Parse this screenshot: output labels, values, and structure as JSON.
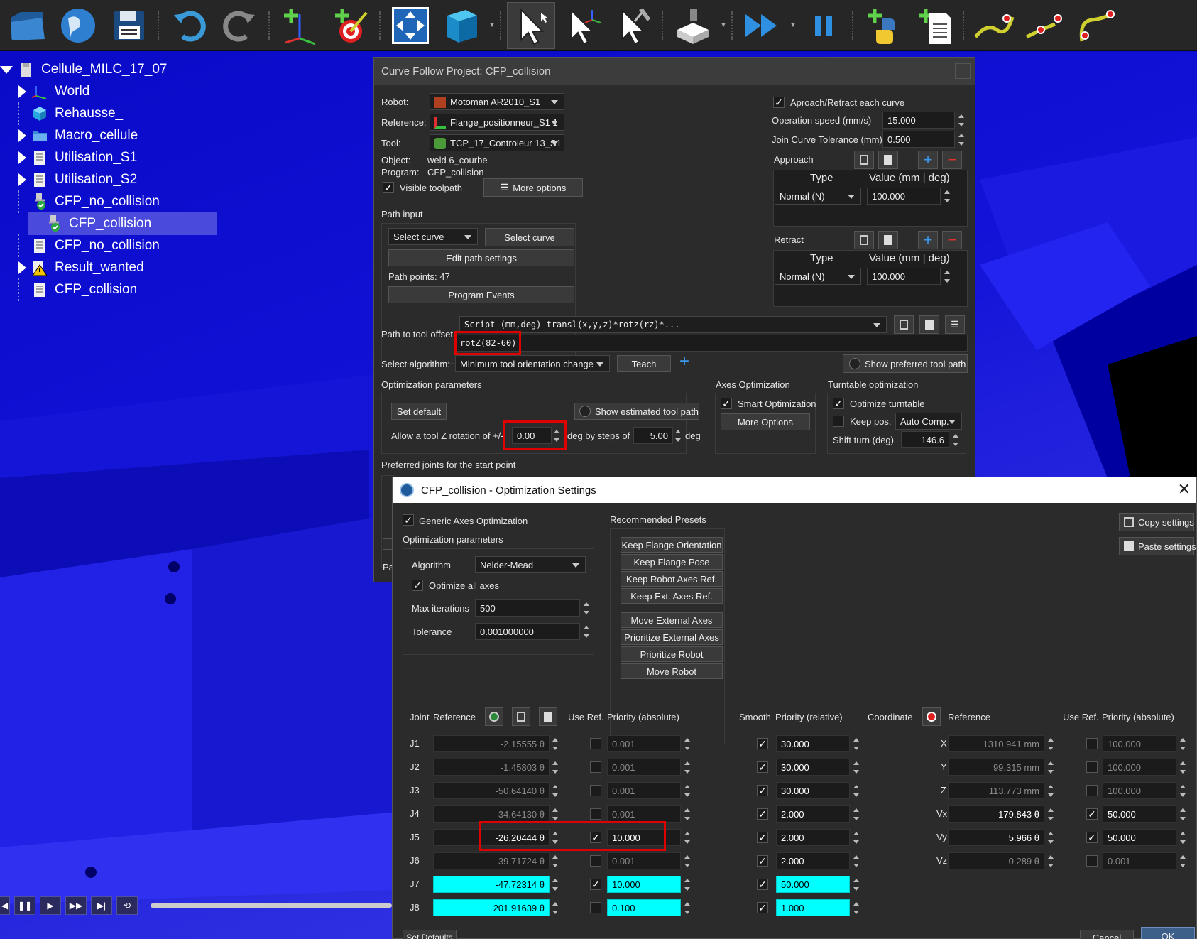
{
  "toolbar": {
    "icons": [
      "open-folder-icon",
      "globe-icon",
      "save-icon",
      "undo-icon",
      "redo-icon",
      "add-reference-frame-icon",
      "add-target-icon",
      "fit-all-icon",
      "cube-view-icon",
      "select-pointer-icon",
      "select-frame-icon",
      "select-tool-icon",
      "tool-holder-icon",
      "fast-forward-icon",
      "pause-icon",
      "python-icon",
      "new-program-icon",
      "curve-point-icon",
      "curve-follow-icon",
      "curve-path-icon"
    ]
  },
  "tree": {
    "root": "Cellule_MILC_17_07",
    "items": [
      {
        "label": "World",
        "icon": "reference-frame-icon"
      },
      {
        "label": "Rehausse_",
        "icon": "cube-icon"
      },
      {
        "label": "Macro_cellule",
        "icon": "folder-icon"
      },
      {
        "label": "Utilisation_S1",
        "icon": "program-icon"
      },
      {
        "label": "Utilisation_S2",
        "icon": "program-icon"
      },
      {
        "label": "CFP_no_collision",
        "icon": "curve-follow-ok-icon"
      },
      {
        "label": "CFP_collision",
        "icon": "curve-follow-ok-icon"
      },
      {
        "label": "CFP_no_collision",
        "icon": "program-icon"
      },
      {
        "label": "Result_wanted",
        "icon": "warning-icon"
      },
      {
        "label": "CFP_collision",
        "icon": "program-icon"
      }
    ]
  },
  "main": {
    "title": "Curve Follow Project: CFP_collision",
    "robot_label": "Robot:",
    "robot_value": "Motoman AR2010_S1",
    "reference_label": "Reference:",
    "reference_value": "Flange_positionneur_S1 1",
    "tool_label": "Tool:",
    "tool_value": "TCP_17_Controleur 13_S1",
    "object_label": "Object:",
    "object_value": "weld 6_courbe",
    "program_label": "Program:",
    "program_value": "CFP_collision",
    "visible_toolpath": "Visible toolpath",
    "more_options": "More options",
    "path_input": "Path input",
    "select_curve_combo": "Select curve",
    "select_curve_btn": "Select curve",
    "edit_path_settings": "Edit path settings",
    "path_points": "Path points: 47",
    "program_events": "Program Events",
    "approach_retract": "Aproach/Retract each curve",
    "op_speed_label": "Operation speed (mm/s)",
    "op_speed_value": "15.000",
    "join_tol_label": "Join Curve Tolerance (mm)",
    "join_tol_value": "0.500",
    "approach": "Approach",
    "retract": "Retract",
    "type_header": "Type",
    "value_header": "Value (mm | deg)",
    "approach_type": "Normal (N)",
    "approach_value": "100.000",
    "retract_type": "Normal (N)",
    "retract_value": "100.000",
    "path_tool_offset_label": "Path to tool offset",
    "script_combo": "Script (mm,deg) transl(x,y,z)*rotz(rz)*...",
    "offset_value": "rotZ(82-60)",
    "select_algorithm_label": "Select algorithm:",
    "algorithm_value": "Minimum tool orientation change",
    "teach": "Teach",
    "show_preferred": "Show preferred tool path",
    "opt_params": "Optimization parameters",
    "set_default": "Set default",
    "show_estimated": "Show estimated tool path",
    "allow_rot_label": "Allow a tool Z rotation of +/-",
    "allow_rot_value": "0.00",
    "deg_steps_label": "deg by steps of",
    "steps_value": "5.00",
    "deg": "deg",
    "axes_opt": "Axes Optimization",
    "smart_opt": "Smart Optimization",
    "more_options2": "More Options",
    "turntable_opt": "Turntable optimization",
    "optimize_turntable": "Optimize turntable",
    "keep_pos": "Keep pos.",
    "auto_comp": "Auto Comp.",
    "shift_turn_label": "Shift turn (deg)",
    "shift_turn_value": "146.6",
    "preferred_joints": "Preferred joints for the start point",
    "pa_text": "Pa"
  },
  "opt": {
    "title": "CFP_collision - Optimization Settings",
    "generic": "Generic Axes Optimization",
    "opt_params": "Optimization parameters",
    "algorithm_label": "Algorithm",
    "algorithm_value": "Nelder-Mead",
    "optimize_all": "Optimize all axes",
    "max_iter_label": "Max iterations",
    "max_iter_value": "500",
    "tolerance_label": "Tolerance",
    "tolerance_value": "0.001000000",
    "presets_title": "Recommended Presets",
    "presets": [
      "Keep Flange Orientation",
      "Keep Flange Pose",
      "Keep Robot Axes Ref.",
      "Keep Ext. Axes Ref.",
      "Move External Axes",
      "Prioritize External Axes",
      "Prioritize Robot",
      "Move Robot"
    ],
    "copy_settings": "Copy settings",
    "paste_settings": "Paste settings",
    "headers": {
      "joint": "Joint",
      "reference": "Reference",
      "use_ref": "Use Ref.",
      "priority_abs": "Priority (absolute)",
      "smooth": "Smooth",
      "priority_rel": "Priority (relative)",
      "coordinate": "Coordinate",
      "reference2": "Reference",
      "use_ref2": "Use Ref.",
      "priority_abs2": "Priority (absolute)"
    },
    "joints": [
      {
        "name": "J1",
        "ref": "-2.15555 θ",
        "use": false,
        "prio": "0.001",
        "smooth": true,
        "rel": "30.000",
        "state": "dim"
      },
      {
        "name": "J2",
        "ref": "-1.45803 θ",
        "use": false,
        "prio": "0.001",
        "smooth": true,
        "rel": "30.000",
        "state": "dim"
      },
      {
        "name": "J3",
        "ref": "-50.64140 θ",
        "use": false,
        "prio": "0.001",
        "smooth": true,
        "rel": "30.000",
        "state": "dim"
      },
      {
        "name": "J4",
        "ref": "-34.64130 θ",
        "use": false,
        "prio": "0.001",
        "smooth": true,
        "rel": "2.000",
        "state": "dim"
      },
      {
        "name": "J5",
        "ref": "-26.20444 θ",
        "use": true,
        "prio": "10.000",
        "smooth": true,
        "rel": "2.000",
        "state": "act"
      },
      {
        "name": "J6",
        "ref": "39.71724 θ",
        "use": false,
        "prio": "0.001",
        "smooth": true,
        "rel": "2.000",
        "state": "dim"
      },
      {
        "name": "J7",
        "ref": "-47.72314 θ",
        "use": true,
        "prio": "10.000",
        "smooth": true,
        "rel": "50.000",
        "state": "cyan"
      },
      {
        "name": "J8",
        "ref": "201.91639 θ",
        "use": false,
        "prio": "0.100",
        "smooth": true,
        "rel": "1.000",
        "state": "cyan"
      }
    ],
    "coords": [
      {
        "name": "X",
        "ref": "1310.941 mm",
        "use": false,
        "prio": "100.000",
        "state": "dim"
      },
      {
        "name": "Y",
        "ref": "99.315 mm",
        "use": false,
        "prio": "100.000",
        "state": "dim"
      },
      {
        "name": "Z",
        "ref": "113.773 mm",
        "use": false,
        "prio": "100.000",
        "state": "dim"
      },
      {
        "name": "Vx",
        "ref": "179.843 θ",
        "use": true,
        "prio": "50.000",
        "state": "act"
      },
      {
        "name": "Vy",
        "ref": "5.966 θ",
        "use": true,
        "prio": "50.000",
        "state": "act"
      },
      {
        "name": "Vz",
        "ref": "0.289 θ",
        "use": false,
        "prio": "0.001",
        "state": "dim"
      }
    ],
    "set_defaults": "Set Defaults",
    "cancel": "Cancel",
    "ok": "OK"
  },
  "colors": {
    "cyan": "#00ffff",
    "red_highlight": "#e00000",
    "viewport_blue": "#0a0ac8"
  }
}
